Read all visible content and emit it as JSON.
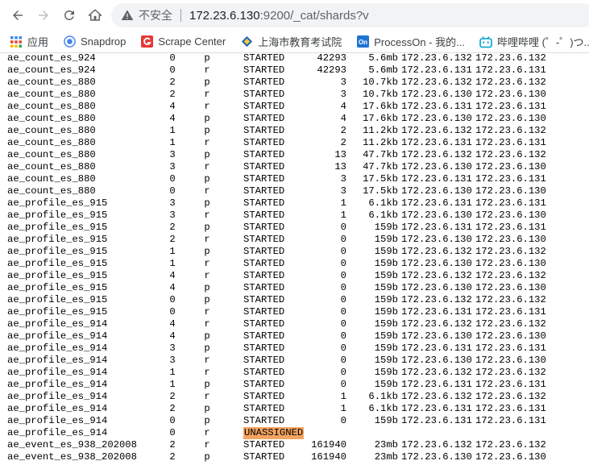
{
  "browser": {
    "security_label": "不安全",
    "url_host": "172.23.6.130",
    "url_rest": ":9200/_cat/shards?v"
  },
  "bookmarks": [
    {
      "label": "应用",
      "icon": "apps-grid-icon",
      "color": "#4285f4"
    },
    {
      "label": "Snapdrop",
      "icon": "snapdrop-icon",
      "color": "#4285f4"
    },
    {
      "label": "Scrape Center",
      "icon": "scrape-center-icon",
      "color": "#e53935"
    },
    {
      "label": "上海市教育考试院",
      "icon": "exam-institute-icon",
      "color": "#1565c0"
    },
    {
      "label": "ProcessOn - 我的...",
      "icon": "processon-icon",
      "color": "#1e73d6"
    },
    {
      "label": "哔哩哔哩 (゜-゜)つ...",
      "icon": "bilibili-icon",
      "color": "#00a1d6"
    }
  ],
  "highlight_color": "#f4a460",
  "shards": [
    {
      "index": "ae_count_es_924",
      "shard": "0",
      "prirep": "p",
      "state": "STARTED",
      "docs": "42293",
      "store": "5.6mb",
      "ip": "172.23.6.132",
      "node": "172.23.6.132"
    },
    {
      "index": "ae_count_es_924",
      "shard": "0",
      "prirep": "r",
      "state": "STARTED",
      "docs": "42293",
      "store": "5.6mb",
      "ip": "172.23.6.131",
      "node": "172.23.6.131"
    },
    {
      "index": "ae_count_es_880",
      "shard": "2",
      "prirep": "p",
      "state": "STARTED",
      "docs": "3",
      "store": "10.7kb",
      "ip": "172.23.6.132",
      "node": "172.23.6.132"
    },
    {
      "index": "ae_count_es_880",
      "shard": "2",
      "prirep": "r",
      "state": "STARTED",
      "docs": "3",
      "store": "10.7kb",
      "ip": "172.23.6.130",
      "node": "172.23.6.130"
    },
    {
      "index": "ae_count_es_880",
      "shard": "4",
      "prirep": "r",
      "state": "STARTED",
      "docs": "4",
      "store": "17.6kb",
      "ip": "172.23.6.131",
      "node": "172.23.6.131"
    },
    {
      "index": "ae_count_es_880",
      "shard": "4",
      "prirep": "p",
      "state": "STARTED",
      "docs": "4",
      "store": "17.6kb",
      "ip": "172.23.6.130",
      "node": "172.23.6.130"
    },
    {
      "index": "ae_count_es_880",
      "shard": "1",
      "prirep": "p",
      "state": "STARTED",
      "docs": "2",
      "store": "11.2kb",
      "ip": "172.23.6.132",
      "node": "172.23.6.132"
    },
    {
      "index": "ae_count_es_880",
      "shard": "1",
      "prirep": "r",
      "state": "STARTED",
      "docs": "2",
      "store": "11.2kb",
      "ip": "172.23.6.131",
      "node": "172.23.6.131"
    },
    {
      "index": "ae_count_es_880",
      "shard": "3",
      "prirep": "p",
      "state": "STARTED",
      "docs": "13",
      "store": "47.7kb",
      "ip": "172.23.6.132",
      "node": "172.23.6.132"
    },
    {
      "index": "ae_count_es_880",
      "shard": "3",
      "prirep": "r",
      "state": "STARTED",
      "docs": "13",
      "store": "47.7kb",
      "ip": "172.23.6.130",
      "node": "172.23.6.130"
    },
    {
      "index": "ae_count_es_880",
      "shard": "0",
      "prirep": "p",
      "state": "STARTED",
      "docs": "3",
      "store": "17.5kb",
      "ip": "172.23.6.131",
      "node": "172.23.6.131"
    },
    {
      "index": "ae_count_es_880",
      "shard": "0",
      "prirep": "r",
      "state": "STARTED",
      "docs": "3",
      "store": "17.5kb",
      "ip": "172.23.6.130",
      "node": "172.23.6.130"
    },
    {
      "index": "ae_profile_es_915",
      "shard": "3",
      "prirep": "p",
      "state": "STARTED",
      "docs": "1",
      "store": "6.1kb",
      "ip": "172.23.6.131",
      "node": "172.23.6.131"
    },
    {
      "index": "ae_profile_es_915",
      "shard": "3",
      "prirep": "r",
      "state": "STARTED",
      "docs": "1",
      "store": "6.1kb",
      "ip": "172.23.6.130",
      "node": "172.23.6.130"
    },
    {
      "index": "ae_profile_es_915",
      "shard": "2",
      "prirep": "p",
      "state": "STARTED",
      "docs": "0",
      "store": "159b",
      "ip": "172.23.6.131",
      "node": "172.23.6.131"
    },
    {
      "index": "ae_profile_es_915",
      "shard": "2",
      "prirep": "r",
      "state": "STARTED",
      "docs": "0",
      "store": "159b",
      "ip": "172.23.6.130",
      "node": "172.23.6.130"
    },
    {
      "index": "ae_profile_es_915",
      "shard": "1",
      "prirep": "p",
      "state": "STARTED",
      "docs": "0",
      "store": "159b",
      "ip": "172.23.6.132",
      "node": "172.23.6.132"
    },
    {
      "index": "ae_profile_es_915",
      "shard": "1",
      "prirep": "r",
      "state": "STARTED",
      "docs": "0",
      "store": "159b",
      "ip": "172.23.6.130",
      "node": "172.23.6.130"
    },
    {
      "index": "ae_profile_es_915",
      "shard": "4",
      "prirep": "r",
      "state": "STARTED",
      "docs": "0",
      "store": "159b",
      "ip": "172.23.6.132",
      "node": "172.23.6.132"
    },
    {
      "index": "ae_profile_es_915",
      "shard": "4",
      "prirep": "p",
      "state": "STARTED",
      "docs": "0",
      "store": "159b",
      "ip": "172.23.6.130",
      "node": "172.23.6.130"
    },
    {
      "index": "ae_profile_es_915",
      "shard": "0",
      "prirep": "p",
      "state": "STARTED",
      "docs": "0",
      "store": "159b",
      "ip": "172.23.6.132",
      "node": "172.23.6.132"
    },
    {
      "index": "ae_profile_es_915",
      "shard": "0",
      "prirep": "r",
      "state": "STARTED",
      "docs": "0",
      "store": "159b",
      "ip": "172.23.6.131",
      "node": "172.23.6.131"
    },
    {
      "index": "ae_profile_es_914",
      "shard": "4",
      "prirep": "r",
      "state": "STARTED",
      "docs": "0",
      "store": "159b",
      "ip": "172.23.6.132",
      "node": "172.23.6.132"
    },
    {
      "index": "ae_profile_es_914",
      "shard": "4",
      "prirep": "p",
      "state": "STARTED",
      "docs": "0",
      "store": "159b",
      "ip": "172.23.6.130",
      "node": "172.23.6.130"
    },
    {
      "index": "ae_profile_es_914",
      "shard": "3",
      "prirep": "p",
      "state": "STARTED",
      "docs": "0",
      "store": "159b",
      "ip": "172.23.6.131",
      "node": "172.23.6.131"
    },
    {
      "index": "ae_profile_es_914",
      "shard": "3",
      "prirep": "r",
      "state": "STARTED",
      "docs": "0",
      "store": "159b",
      "ip": "172.23.6.130",
      "node": "172.23.6.130"
    },
    {
      "index": "ae_profile_es_914",
      "shard": "1",
      "prirep": "r",
      "state": "STARTED",
      "docs": "0",
      "store": "159b",
      "ip": "172.23.6.132",
      "node": "172.23.6.132"
    },
    {
      "index": "ae_profile_es_914",
      "shard": "1",
      "prirep": "p",
      "state": "STARTED",
      "docs": "0",
      "store": "159b",
      "ip": "172.23.6.131",
      "node": "172.23.6.131"
    },
    {
      "index": "ae_profile_es_914",
      "shard": "2",
      "prirep": "r",
      "state": "STARTED",
      "docs": "1",
      "store": "6.1kb",
      "ip": "172.23.6.132",
      "node": "172.23.6.132"
    },
    {
      "index": "ae_profile_es_914",
      "shard": "2",
      "prirep": "p",
      "state": "STARTED",
      "docs": "1",
      "store": "6.1kb",
      "ip": "172.23.6.131",
      "node": "172.23.6.131"
    },
    {
      "index": "ae_profile_es_914",
      "shard": "0",
      "prirep": "p",
      "state": "STARTED",
      "docs": "0",
      "store": "159b",
      "ip": "172.23.6.131",
      "node": "172.23.6.131"
    },
    {
      "index": "ae_profile_es_914",
      "shard": "0",
      "prirep": "r",
      "state": "UNASSIGNED",
      "docs": "",
      "store": "",
      "ip": "",
      "node": ""
    },
    {
      "index": "ae_event_es_938_202008",
      "shard": "2",
      "prirep": "r",
      "state": "STARTED",
      "docs": "161940",
      "store": "23mb",
      "ip": "172.23.6.132",
      "node": "172.23.6.132"
    },
    {
      "index": "ae_event_es_938_202008",
      "shard": "2",
      "prirep": "p",
      "state": "STARTED",
      "docs": "161940",
      "store": "23mb",
      "ip": "172.23.6.130",
      "node": "172.23.6.130"
    }
  ]
}
